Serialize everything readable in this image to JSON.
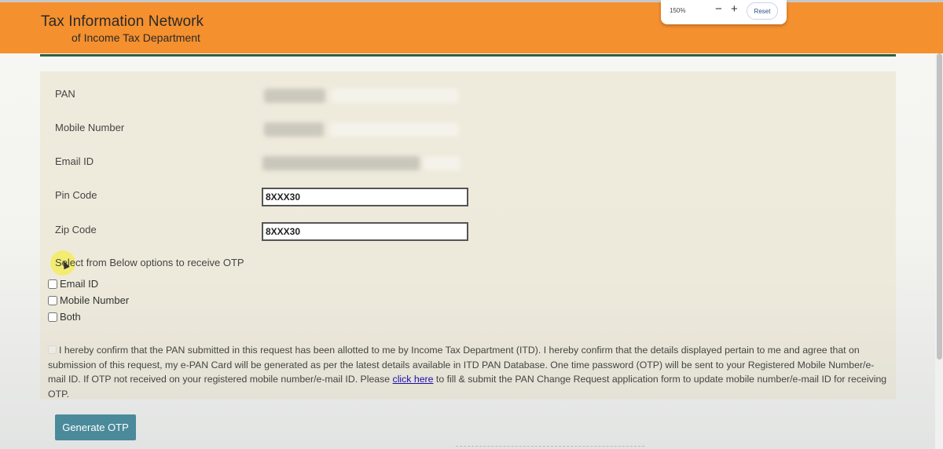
{
  "header": {
    "title_line1": "Tax Information Network",
    "title_line2": "of Income Tax Department",
    "bg_color": "#f5902e"
  },
  "zoom": {
    "level": "150%",
    "minus": "−",
    "plus": "+",
    "reset_label": "Reset"
  },
  "form": {
    "pan_label": "PAN",
    "mobile_label": "Mobile Number",
    "email_label": "Email ID",
    "pincode_label": "Pin Code",
    "pincode_value": "8XXX30",
    "zipcode_label": "Zip Code",
    "zipcode_value": "8XXX30"
  },
  "otp": {
    "title": "Select from Below options to receive OTP",
    "options": [
      "Email ID",
      "Mobile Number",
      "Both"
    ]
  },
  "confirm": {
    "text_before_link": "I hereby confirm that the PAN submitted in this request has been allotted to me by Income Tax Department (ITD). I hereby confirm that the details displayed pertain to me and agree that on submission of this request, my e-PAN Card will be generated as per the latest details available in ITD PAN Database. One time password (OTP) will be sent to your Registered Mobile Number/e-mail ID. If OTP not received on your registered mobile number/e-mail ID. Please ",
    "link_text": "click here",
    "text_after_link": " to fill & submit the PAN Change Request application form to update mobile number/e-mail ID for receiving OTP."
  },
  "actions": {
    "generate_otp_label": "Generate OTP"
  }
}
